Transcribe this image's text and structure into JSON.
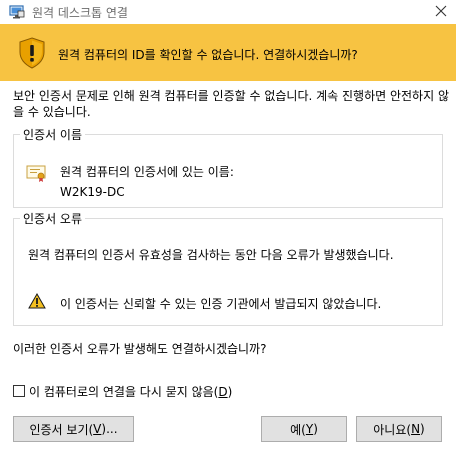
{
  "window": {
    "title": "원격 데스크톱 연결",
    "app_icon": "remote-desktop-icon",
    "close_icon": "close-icon"
  },
  "banner": {
    "icon": "shield-warning-icon",
    "text": "원격 컴퓨터의 ID를 확인할 수 없습니다. 연결하시겠습니까?",
    "color": "#f7c342"
  },
  "warning_paragraph": "보안 인증서 문제로 인해 원격 컴퓨터를 인증할 수 없습니다. 계속 진행하면 안전하지 않을 수 있습니다.",
  "cert_name_group": {
    "legend": "인증서 이름",
    "icon": "certificate-icon",
    "label": "원격 컴퓨터의 인증서에 있는 이름:",
    "value": "W2K19-DC"
  },
  "cert_error_group": {
    "legend": "인증서 오류",
    "description": "원격 컴퓨터의 인증서 유효성을 검사하는 동안 다음 오류가 발생했습니다.",
    "icon": "warning-triangle-icon",
    "error_text": "이 인증서는 신뢰할 수 있는 인증 기관에서 발급되지 않았습니다."
  },
  "question": "이러한 인증서 오류가 발생해도 연결하시겠습니까?",
  "checkbox": {
    "label_prefix": "이 컴퓨터로의 연결을 다시 묻지 않음(",
    "label_key": "D",
    "label_suffix": ")",
    "checked": false
  },
  "buttons": {
    "view_cert": {
      "prefix": "인증서 보기(",
      "key": "V",
      "suffix": ")..."
    },
    "yes": {
      "prefix": "예(",
      "key": "Y",
      "suffix": ")"
    },
    "no": {
      "prefix": "아니요(",
      "key": "N",
      "suffix": ")"
    }
  }
}
